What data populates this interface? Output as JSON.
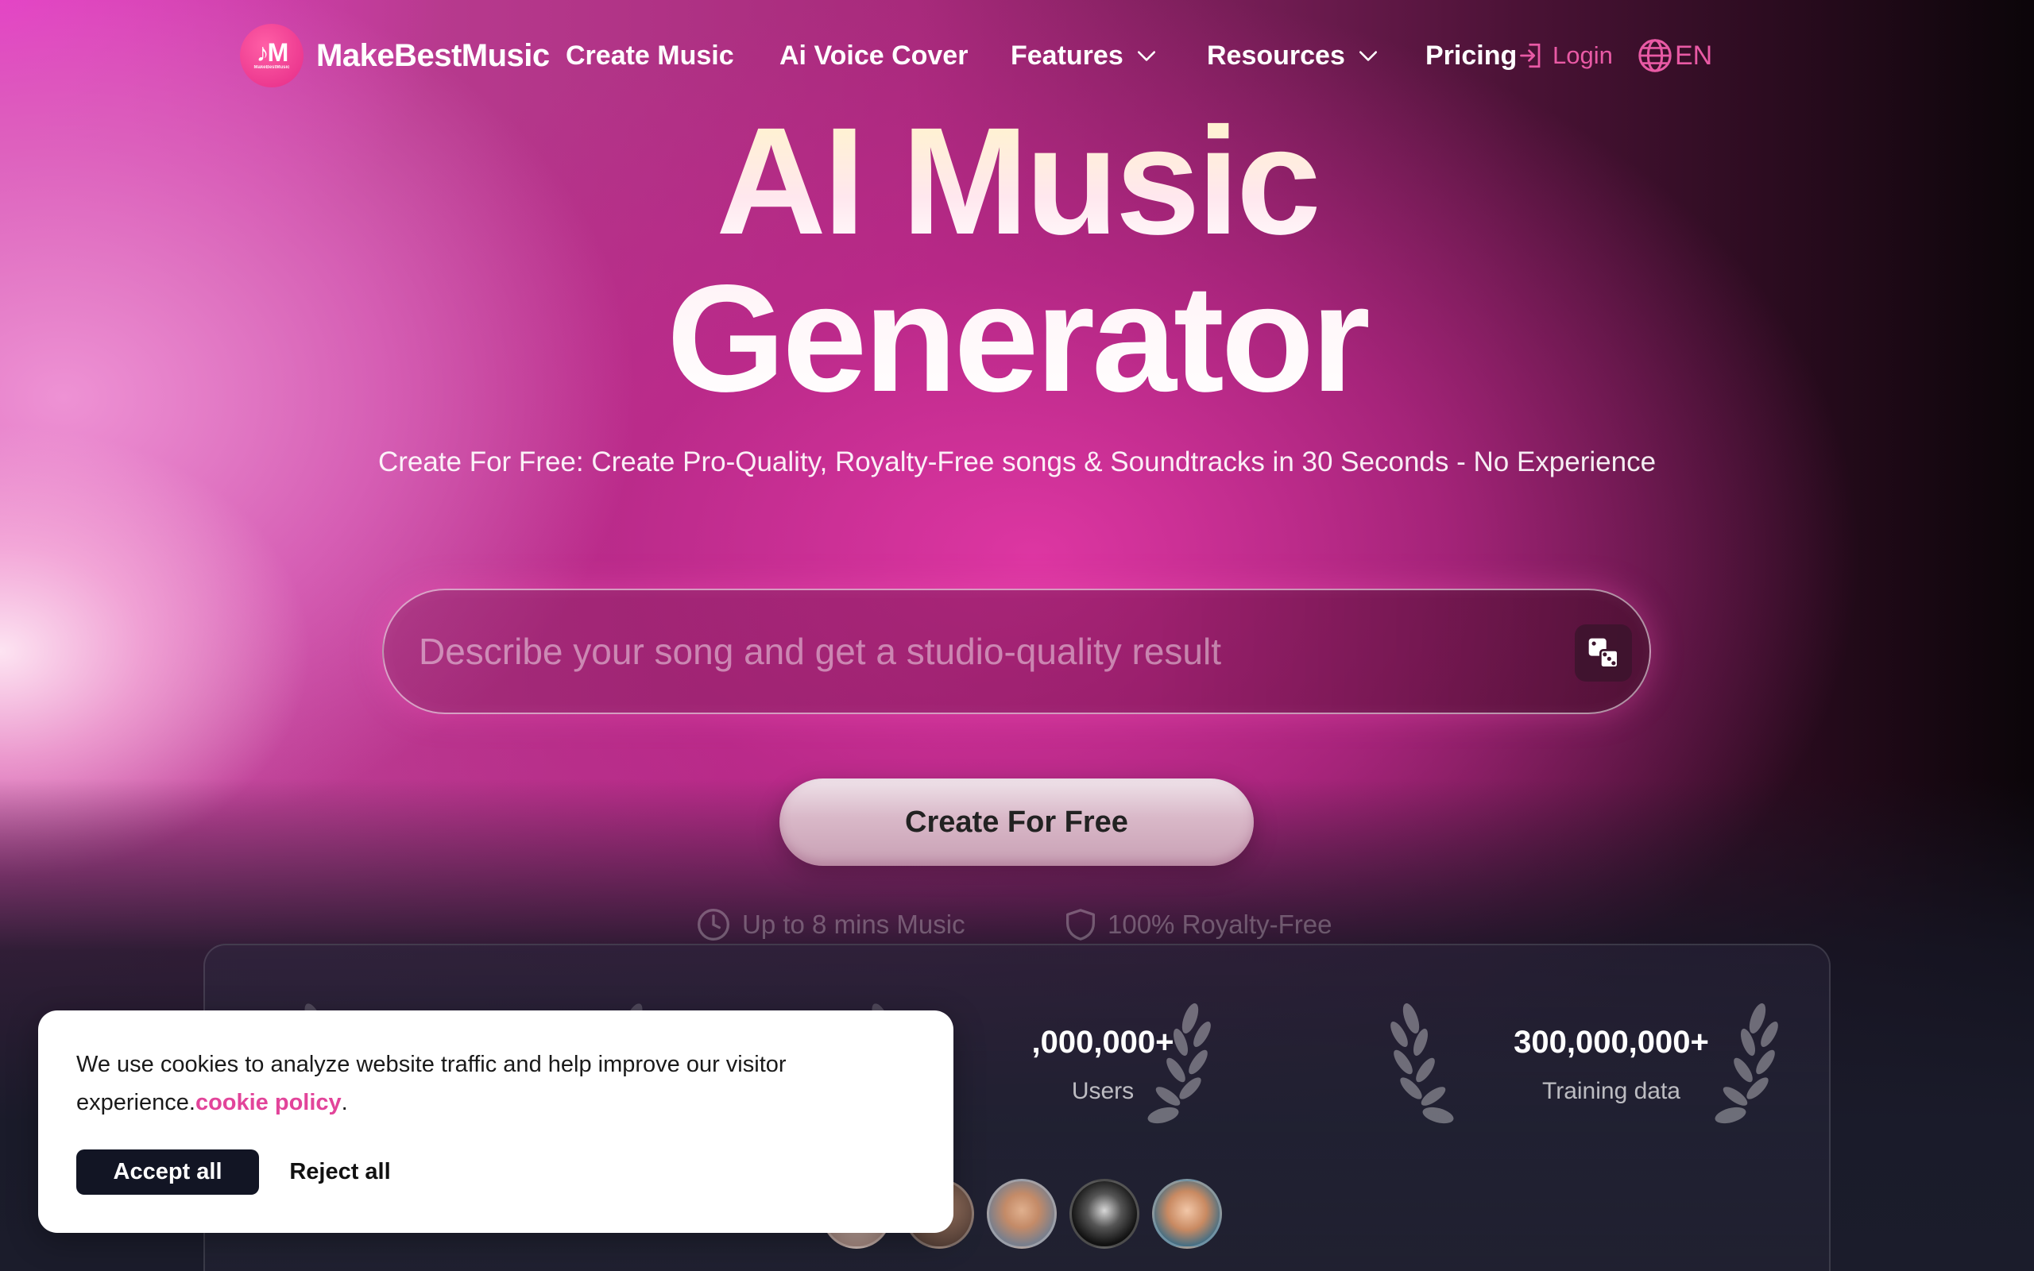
{
  "nav": {
    "brand": "MakeBestMusic",
    "logo_small_text": "MakeBestMusic",
    "links": [
      {
        "label": "Create Music"
      },
      {
        "label": "Ai Voice Cover"
      },
      {
        "label": "Features",
        "has_dropdown": true
      },
      {
        "label": "Resources",
        "has_dropdown": true
      },
      {
        "label": "Pricing"
      }
    ],
    "login_label": "Login",
    "language": "EN"
  },
  "hero": {
    "title_line1": "AI Music",
    "title_line2": "Generator",
    "subtitle": "Create For Free: Create Pro-Quality, Royalty-Free songs & Soundtracks in 30 Seconds - No Experience"
  },
  "prompt": {
    "placeholder": "Describe your song and get a studio-quality result",
    "value": ""
  },
  "cta_label": "Create For Free",
  "features": [
    {
      "icon": "clock-icon",
      "label": "Up to 8 mins Music"
    },
    {
      "icon": "shield-icon",
      "label": "100% Royalty-Free"
    }
  ],
  "stats": [
    {
      "value": ",000,000+",
      "label": "Users"
    },
    {
      "value": "300,000,000+",
      "label": "Training data"
    }
  ],
  "cookie": {
    "text": "We use cookies to analyze website traffic and help improve our visitor experience.",
    "link_text": "cookie policy",
    "suffix": ".",
    "accept_label": "Accept all",
    "reject_label": "Reject all"
  },
  "colors": {
    "accent_pink": "#e2449a",
    "brand_pink": "#e52a87",
    "cookie_button_dark": "#121524"
  }
}
